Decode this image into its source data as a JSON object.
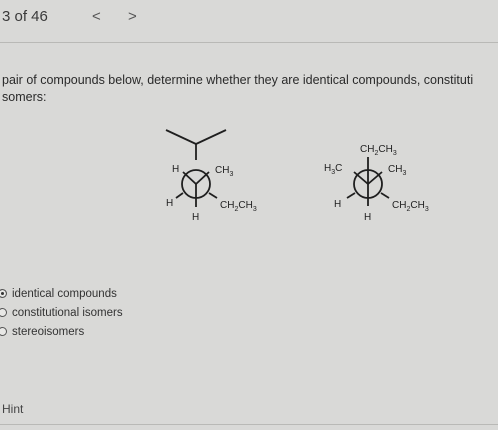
{
  "header": {
    "page_counter": "3 of 46",
    "prev_label": "<",
    "next_label": ">"
  },
  "question": {
    "line1": "pair of compounds below, determine whether they are identical compounds, constituti",
    "line2": "somers:"
  },
  "molecules": {
    "left": {
      "back_substituents": [
        "",
        "",
        ""
      ],
      "front_left": "H",
      "front_right": "CH3",
      "back_left": "H",
      "back_right": "CH2CH3",
      "bottom": "H"
    },
    "right": {
      "top": "CH2CH3",
      "front_left": "H3C",
      "front_right": "CH3",
      "back_left": "H",
      "back_right": "CH2CH3",
      "bottom": "H"
    }
  },
  "options": [
    {
      "label": "identical compounds",
      "checked": true
    },
    {
      "label": "constitutional isomers",
      "checked": false
    },
    {
      "label": "stereoisomers",
      "checked": false
    }
  ],
  "hint_label": "Hint"
}
